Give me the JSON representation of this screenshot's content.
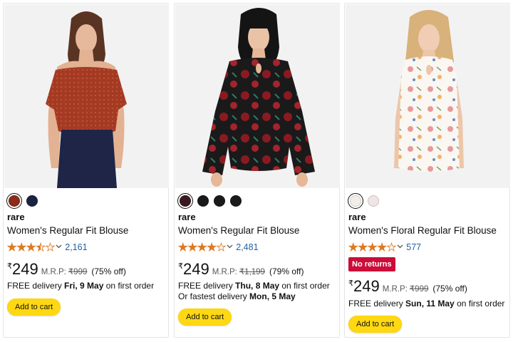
{
  "products": [
    {
      "swatches": [
        "#8b2b18",
        "#1c2340"
      ],
      "brand": "rare",
      "title": "Women's Regular Fit Blouse",
      "rating": 3.5,
      "review_count": "2,161",
      "currency": "₹",
      "price": "249",
      "mrp_label": "M.R.P:",
      "mrp": "₹999",
      "discount": "(75% off)",
      "delivery_prefix": "FREE delivery ",
      "delivery_date": "Fri, 9 May",
      "delivery_suffix": " on first order",
      "add_to_cart": "Add to cart"
    },
    {
      "swatches": [
        "#3a1a20",
        "#1a1a1a",
        "#1a1a1a",
        "#1a1a1a"
      ],
      "brand": "rare",
      "title": "Women's Regular Fit Blouse",
      "rating": 4,
      "review_count": "2,481",
      "currency": "₹",
      "price": "249",
      "mrp_label": "M.R.P:",
      "mrp": "₹1,199",
      "discount": "(79% off)",
      "delivery_prefix": "FREE delivery ",
      "delivery_date": "Thu, 8 May",
      "delivery_suffix": " on first order",
      "fastest_prefix": "Or fastest delivery ",
      "fastest_date": "Mon, 5 May",
      "add_to_cart": "Add to cart"
    },
    {
      "swatches": [
        "#f3efe8",
        "#efe4e6"
      ],
      "brand": "rare",
      "title": "Women's Floral Regular Fit Blouse",
      "rating": 4,
      "review_count": "577",
      "badge": "No returns",
      "currency": "₹",
      "price": "249",
      "mrp_label": "M.R.P:",
      "mrp": "₹999",
      "discount": "(75% off)",
      "delivery_prefix": "FREE delivery ",
      "delivery_date": "Sun, 11 May",
      "delivery_suffix": " on first order",
      "add_to_cart": "Add to cart"
    }
  ],
  "colors": {
    "star": "#de7921",
    "link": "#2162a1",
    "badge": "#cc0c39",
    "button": "#ffd814"
  },
  "icons": {
    "rating": "star-icon",
    "dropdown": "chevron-down-icon"
  }
}
